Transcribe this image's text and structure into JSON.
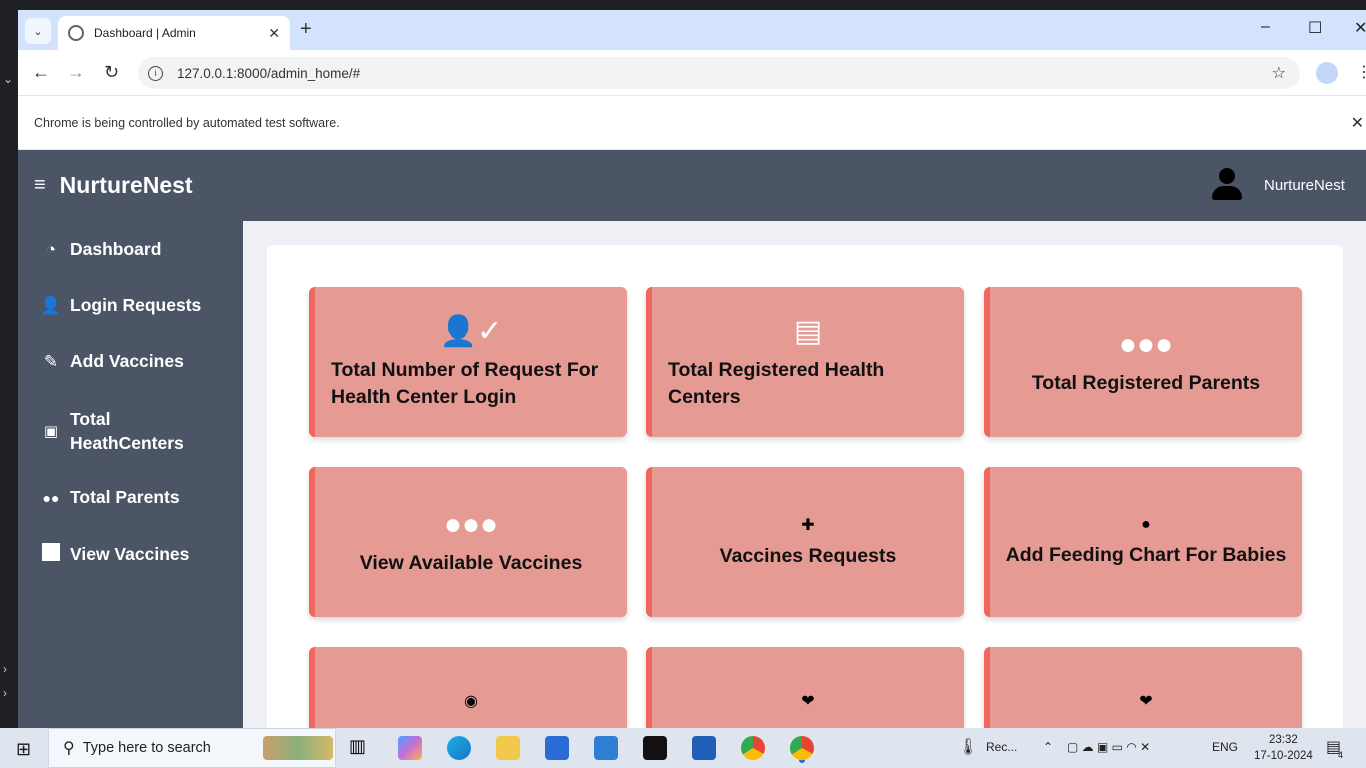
{
  "browser": {
    "tab_title": "Dashboard | Admin",
    "url": "127.0.0.1:8000/admin_home/#",
    "infobar_text": "Chrome is being controlled by automated test software."
  },
  "app": {
    "brand": "NurtureNest",
    "user_name": "NurtureNest"
  },
  "sidebar": {
    "items": [
      {
        "label": "Dashboard",
        "icon": "gauge-icon"
      },
      {
        "label": "Login Requests",
        "icon": "user-check-icon"
      },
      {
        "label": "Add Vaccines",
        "icon": "syringe-icon"
      },
      {
        "label": "Total",
        "label2": "HeathCenters",
        "icon": "hospital-icon"
      },
      {
        "label": "Total Parents",
        "icon": "users-icon"
      },
      {
        "label": "View Vaccines",
        "icon": "square-icon"
      }
    ]
  },
  "cards": [
    {
      "title": "Total Number of Request For Health Center Login",
      "icon": "user-check-icon"
    },
    {
      "title": "Total Registered Health Centers",
      "icon": "hospital-icon"
    },
    {
      "title": "Total Registered Parents",
      "icon": "users-icon"
    },
    {
      "title": "View Available Vaccines",
      "icon": "users-icon"
    },
    {
      "title": "Vaccines Requests",
      "icon": "clipboard-plus-icon"
    },
    {
      "title": "Add Feeding Chart For Babies",
      "icon": "apple-icon"
    },
    {
      "title": "",
      "icon": "eye-icon"
    },
    {
      "title": "",
      "icon": "hand-heart-icon"
    },
    {
      "title": "",
      "icon": "hand-heart-icon"
    }
  ],
  "taskbar": {
    "search_placeholder": "Type here to search",
    "weather_label": "Rec...",
    "lang": "ENG",
    "time": "23:32",
    "date": "17-10-2024",
    "notification_count": "4"
  }
}
